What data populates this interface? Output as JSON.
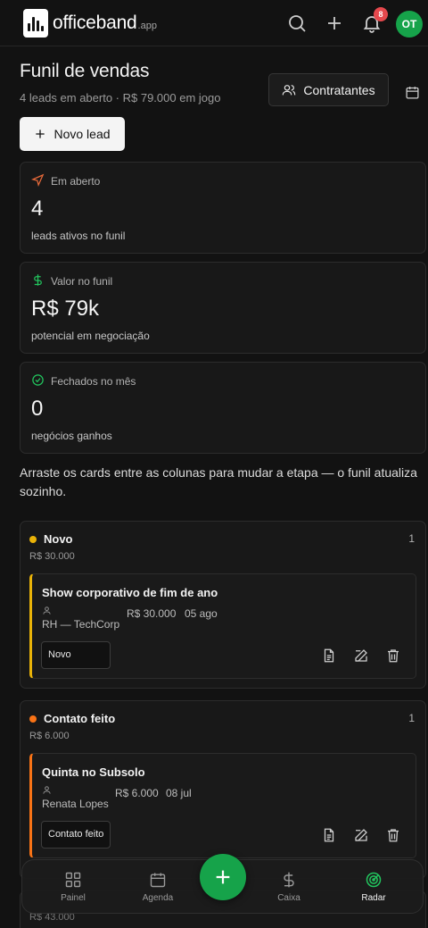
{
  "app": {
    "brand": "officeband",
    "brand_suffix": ".app",
    "notification_count": "8",
    "avatar_initials": "OT"
  },
  "header": {
    "title": "Funil de vendas",
    "subtitle": "4 leads em aberto · R$ 79.000 em jogo",
    "contratantes_label": "Contratantes",
    "new_lead_label": "Novo lead"
  },
  "stats": [
    {
      "label": "Em aberto",
      "value": "4",
      "desc": "leads ativos no funil",
      "icon": "send-icon",
      "color": "#e86a3a"
    },
    {
      "label": "Valor no funil",
      "value": "R$ 79k",
      "desc": "potencial em negociação",
      "icon": "dollar-icon",
      "color": "#22c55e"
    },
    {
      "label": "Fechados no mês",
      "value": "0",
      "desc": "negócios ganhos",
      "icon": "check-circle-icon",
      "color": "#22c55e"
    }
  ],
  "hint": "Arraste os cards entre as colunas para mudar a etapa — o funil atualiza sozinho.",
  "columns": [
    {
      "name": "Novo",
      "count": "1",
      "total": "R$ 30.000",
      "color": "#eab308",
      "cards": [
        {
          "title": "Show corporativo de fim de ano",
          "person": "RH — TechCorp",
          "value": "R$ 30.000",
          "date": "05 ago",
          "stage": "Novo"
        }
      ]
    },
    {
      "name": "Contato feito",
      "count": "1",
      "total": "R$ 6.000",
      "color": "#f97316",
      "cards": [
        {
          "title": "Quinta no Subsolo",
          "person": "Renata Lopes",
          "value": "R$ 6.000",
          "date": "08 jul",
          "stage": "Contato feito"
        }
      ]
    },
    {
      "total": "R$ 43.000"
    }
  ],
  "nav": {
    "items": [
      {
        "label": "Painel",
        "icon": "grid-icon"
      },
      {
        "label": "Agenda",
        "icon": "calendar-icon"
      },
      {
        "label": "Caixa",
        "icon": "dollar-icon"
      },
      {
        "label": "Radar",
        "icon": "radar-icon",
        "active": true
      }
    ],
    "fab_icon": "plus-icon"
  }
}
